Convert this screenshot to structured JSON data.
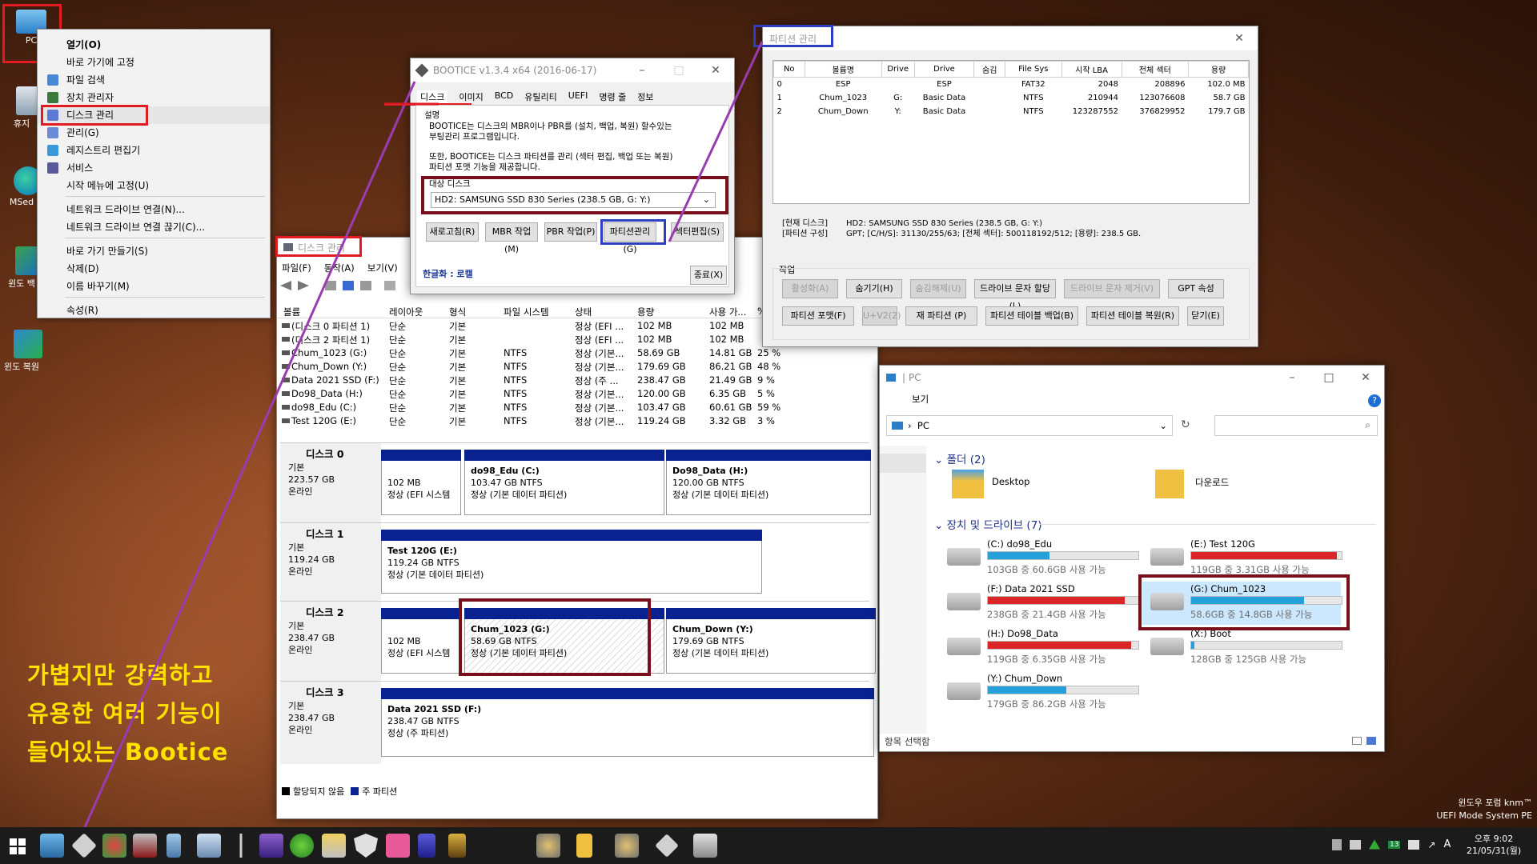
{
  "desktop": {
    "icons": [
      {
        "label": "PC"
      },
      {
        "label": "휴지"
      },
      {
        "label": "MSed"
      },
      {
        "label": "윈도 백"
      },
      {
        "label": "윈도 복원"
      }
    ],
    "caption": [
      "가볍지만 강력하고",
      "유용한 여러 기능이",
      "들어있는 Bootice"
    ],
    "wm1": "윈도우 포럼 knm™",
    "wm2": "UEFI Mode System PE"
  },
  "context_menu": {
    "items": [
      "열기(O)",
      "바로 가기에 고정",
      "파일 검색",
      "장치 관리자",
      "디스크 관리",
      "관리(G)",
      "레지스트리 편집기",
      "서비스",
      "시작 메뉴에 고정(U)",
      "네트워크 드라이브 연결(N)...",
      "네트워크 드라이브 연결 끊기(C)...",
      "바로 가기 만들기(S)",
      "삭제(D)",
      "이름 바꾸기(M)",
      "속성(R)"
    ]
  },
  "bootice": {
    "title": "BOOTICE v1.3.4 x64 (2016-06-17)",
    "tabs": [
      "디스크",
      "이미지",
      "BCD",
      "유틸리티",
      "UEFI",
      "명령 줄",
      "정보"
    ],
    "desc_label": "설명",
    "desc1": "BOOTICE는 디스크의 MBR이나 PBR를 (설치, 백업, 복원) 할수있는",
    "desc2": "부팅관리 프로그램입니다.",
    "desc3": "또한, BOOTICE는 디스크 파티션를 관리 (섹터 편집, 백업 또는 복원)",
    "desc4": "파티션 포맷 기능을 제공합니다.",
    "target_label": "대상 디스크",
    "target_value": "HD2: SAMSUNG SSD 830 Series (238.5 GB, G: Y:)",
    "buttons": [
      "새로고침(R)",
      "MBR 작업(M)",
      "PBR 작업(P)",
      "파티션관리(G)",
      "섹터편집(S)"
    ],
    "lang": "한글화 : 로캘",
    "close": "종료(X)"
  },
  "partmgr": {
    "title": "파티션 관리",
    "headers": [
      "No",
      "볼륨명",
      "Drive",
      "Drive",
      "숨김",
      "File Sys",
      "시작 LBA",
      "전체 섹터",
      "용량"
    ],
    "rows": [
      [
        "0",
        "ESP",
        "",
        "ESP",
        "",
        "FAT32",
        "2048",
        "208896",
        "102.0 MB"
      ],
      [
        "1",
        "Chum_1023",
        "G:",
        "Basic Data",
        "",
        "NTFS",
        "210944",
        "123076608",
        "58.7 GB"
      ],
      [
        "2",
        "Chum_Down",
        "Y:",
        "Basic Data",
        "",
        "NTFS",
        "123287552",
        "376829952",
        "179.7 GB"
      ]
    ],
    "info_l1": "[현재 디스크]",
    "info_l2": "[파티션 구성]",
    "info_r1": "HD2: SAMSUNG SSD 830 Series (238.5 GB, G: Y:)",
    "info_r2": "GPT;     [C/H/S]: 31130/255/63; [전체 섹터]: 500118192/512; [용량]: 238.5 GB.",
    "work_label": "작업",
    "btns1": [
      "활성화(A)",
      "숨기기(H)",
      "숨김해제(U)",
      "드라이브 문자 할당(L)",
      "드라이브 문자 제거(V)",
      "GPT 속성"
    ],
    "btns2": [
      "파티션 포맷(F)",
      "U+V2(2)",
      "재 파티션 (P)",
      "파티션 테이블 백업(B)",
      "파티션 테이블 복원(R)",
      "닫기(E)"
    ]
  },
  "diskmgmt": {
    "title": "디스크 관리",
    "menu": [
      "파일(F)",
      "동작(A)",
      "보기(V)"
    ],
    "headers": [
      "볼륨",
      "레이아웃",
      "형식",
      "파일 시스템",
      "상태",
      "용량",
      "사용 가...",
      "%"
    ],
    "rows": [
      [
        "(디스크 0 파티션 1)",
        "단순",
        "기본",
        "",
        "정상 (EFI ...",
        "102 MB",
        "102 MB",
        ""
      ],
      [
        "(디스크 2 파티션 1)",
        "단순",
        "기본",
        "",
        "정상 (EFI ...",
        "102 MB",
        "102 MB",
        ""
      ],
      [
        "Chum_1023 (G:)",
        "단순",
        "기본",
        "NTFS",
        "정상 (기본...",
        "58.69 GB",
        "14.81 GB",
        "25 %"
      ],
      [
        "Chum_Down (Y:)",
        "단순",
        "기본",
        "NTFS",
        "정상 (기본...",
        "179.69 GB",
        "86.21 GB",
        "48 %"
      ],
      [
        "Data 2021 SSD (F:)",
        "단순",
        "기본",
        "NTFS",
        "정상 (주 ...",
        "238.47 GB",
        "21.49 GB",
        "9 %"
      ],
      [
        "Do98_Data (H:)",
        "단순",
        "기본",
        "NTFS",
        "정상 (기본...",
        "120.00 GB",
        "6.35 GB",
        "5 %"
      ],
      [
        "do98_Edu (C:)",
        "단순",
        "기본",
        "NTFS",
        "정상 (기본...",
        "103.47 GB",
        "60.61 GB",
        "59 %"
      ],
      [
        "Test 120G (E:)",
        "단순",
        "기본",
        "NTFS",
        "정상 (기본...",
        "119.24 GB",
        "3.32 GB",
        "3 %"
      ]
    ],
    "disks": [
      {
        "name": "디스크 0",
        "type": "기본",
        "size": "223.57 GB",
        "state": "온라인",
        "parts": [
          {
            "n": "",
            "s": "102 MB",
            "t": "정상 (EFI 시스템"
          },
          {
            "n": "do98_Edu  (C:)",
            "s": "103.47 GB NTFS",
            "t": "정상 (기본 데이터 파티션)"
          },
          {
            "n": "Do98_Data  (H:)",
            "s": "120.00 GB NTFS",
            "t": "정상 (기본 데이터 파티션)"
          }
        ]
      },
      {
        "name": "디스크 1",
        "type": "기본",
        "size": "119.24 GB",
        "state": "온라인",
        "parts": [
          {
            "n": "Test 120G  (E:)",
            "s": "119.24 GB NTFS",
            "t": "정상 (기본 데이터 파티션)"
          }
        ]
      },
      {
        "name": "디스크 2",
        "type": "기본",
        "size": "238.47 GB",
        "state": "온라인",
        "parts": [
          {
            "n": "",
            "s": "102 MB",
            "t": "정상 (EFI 시스템"
          },
          {
            "n": "Chum_1023  (G:)",
            "s": "58.69 GB NTFS",
            "t": "정상 (기본 데이터 파티션)"
          },
          {
            "n": "Chum_Down  (Y:)",
            "s": "179.69 GB NTFS",
            "t": "정상 (기본 데이터 파티션)"
          }
        ]
      },
      {
        "name": "디스크 3",
        "type": "기본",
        "size": "238.47 GB",
        "state": "온라인",
        "parts": [
          {
            "n": "Data 2021 SSD  (F:)",
            "s": "238.47 GB NTFS",
            "t": "정상 (주 파티션)"
          }
        ]
      }
    ],
    "legend1": "할당되지 않음",
    "legend2": "주 파티션"
  },
  "explorer": {
    "title": "PC",
    "menu": "보기",
    "addr": "PC",
    "folders_hdr": "폴더 (2)",
    "folders": [
      "Desktop",
      "다운로드"
    ],
    "drives_hdr": "장치 및 드라이브 (7)",
    "status": "항목 선택함",
    "drives": [
      {
        "name": "(C:) do98_Edu",
        "size": "103GB 중 60.6GB 사용 가능",
        "pct": 0.41,
        "color": "#26a0da"
      },
      {
        "name": "(E:) Test 120G",
        "size": "119GB 중 3.31GB 사용 가능",
        "pct": 0.97,
        "color": "#da2626"
      },
      {
        "name": "(F:) Data 2021 SSD",
        "size": "238GB 중 21.4GB 사용 가능",
        "pct": 0.91,
        "color": "#da2626"
      },
      {
        "name": "(G:) Chum_1023",
        "size": "58.6GB 중 14.8GB 사용 가능",
        "pct": 0.75,
        "color": "#26a0da"
      },
      {
        "name": "(H:) Do98_Data",
        "size": "119GB 중 6.35GB 사용 가능",
        "pct": 0.95,
        "color": "#da2626"
      },
      {
        "name": "(X:) Boot",
        "size": "128GB 중 125GB 사용 가능",
        "pct": 0.02,
        "color": "#26a0da"
      },
      {
        "name": "(Y:) Chum_Down",
        "size": "179GB 중 86.2GB 사용 가능",
        "pct": 0.52,
        "color": "#26a0da"
      }
    ]
  },
  "taskbar": {
    "time": "오후 9:02",
    "date": "21/05/31(월)",
    "badge": "13",
    "ime": "A"
  }
}
